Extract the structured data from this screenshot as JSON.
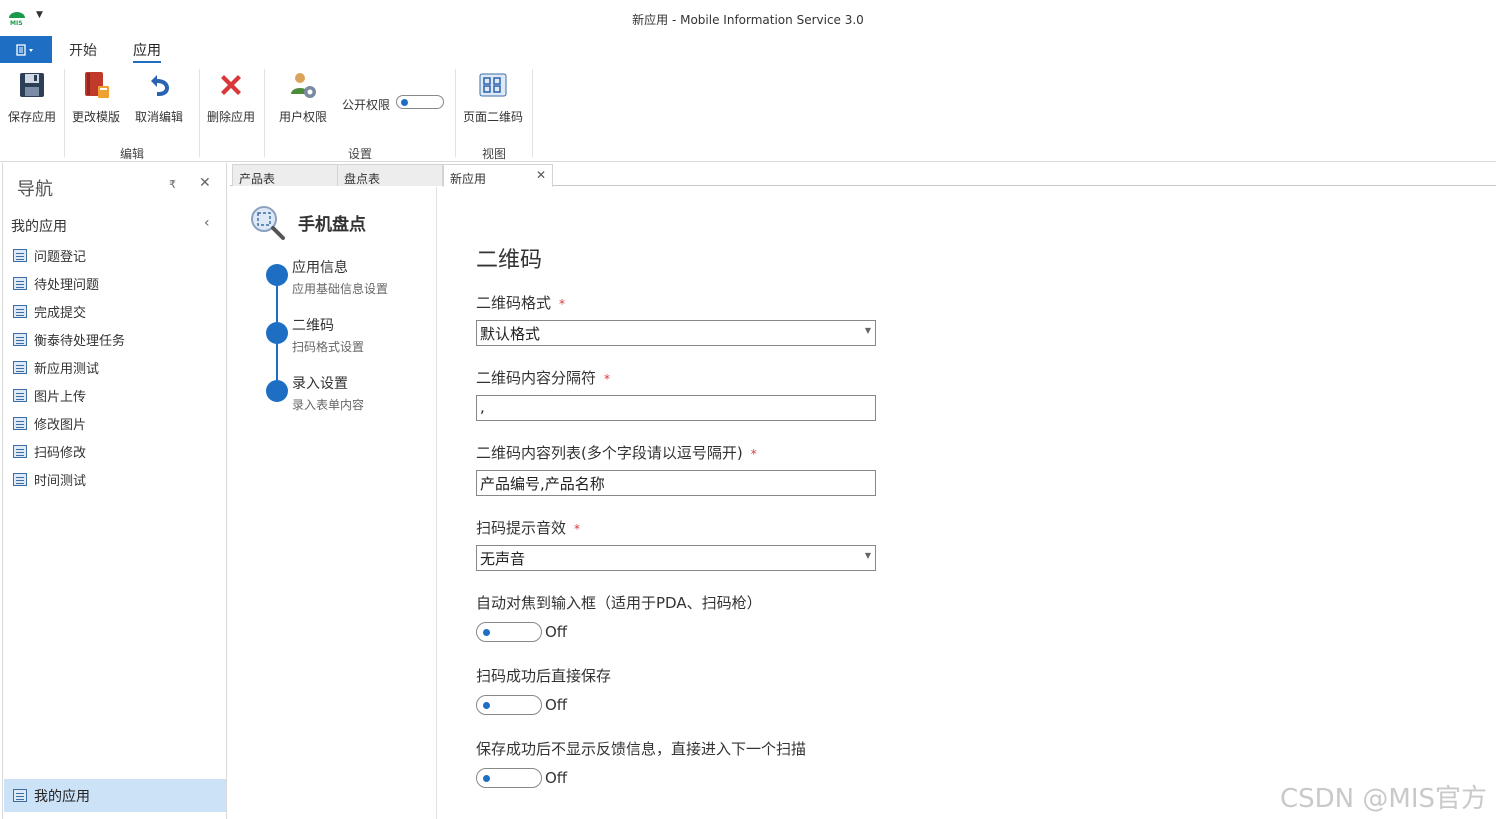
{
  "window": {
    "title": "新应用 - Mobile Information Service 3.0"
  },
  "ribbon": {
    "tabs": [
      {
        "label": "开始"
      },
      {
        "label": "应用"
      }
    ],
    "buttons": {
      "save": "保存应用",
      "change_template": "更改模版",
      "cancel_edit": "取消编辑",
      "delete_app": "删除应用",
      "user_permission": "用户权限",
      "public_permission": "公开权限",
      "page_qrcode": "页面二维码"
    },
    "groups": {
      "edit": "编辑",
      "settings": "设置",
      "view": "视图"
    }
  },
  "nav": {
    "title": "导航",
    "section": "我的应用",
    "items": [
      {
        "label": "问题登记"
      },
      {
        "label": "待处理问题"
      },
      {
        "label": "完成提交"
      },
      {
        "label": "衡泰待处理任务"
      },
      {
        "label": "新应用测试"
      },
      {
        "label": "图片上传"
      },
      {
        "label": "修改图片"
      },
      {
        "label": "扫码修改"
      },
      {
        "label": "时间测试"
      }
    ],
    "footer": "我的应用"
  },
  "doc_tabs": [
    {
      "label": "产品表"
    },
    {
      "label": "盘点表"
    },
    {
      "label": "新应用"
    }
  ],
  "steps": {
    "title": "手机盘点",
    "items": [
      {
        "name": "应用信息",
        "desc": "应用基础信息设置"
      },
      {
        "name": "二维码",
        "desc": "扫码格式设置"
      },
      {
        "name": "录入设置",
        "desc": "录入表单内容"
      }
    ]
  },
  "form": {
    "heading": "二维码",
    "qr_format": {
      "label": "二维码格式",
      "value": "默认格式"
    },
    "separator": {
      "label": "二维码内容分隔符",
      "value": ","
    },
    "content_list": {
      "label": "二维码内容列表(多个字段请以逗号隔开)",
      "value": "产品编号,产品名称"
    },
    "sound": {
      "label": "扫码提示音效",
      "value": "无声音"
    },
    "auto_focus": {
      "label": "自动对焦到输入框（适用于PDA、扫码枪）",
      "state": "Off"
    },
    "save_on_scan": {
      "label": "扫码成功后直接保存",
      "state": "Off"
    },
    "no_feedback": {
      "label": "保存成功后不显示反馈信息，直接进入下一个扫描",
      "state": "Off"
    },
    "required_mark": "*"
  },
  "watermark": "CSDN @MIS官方",
  "colors": {
    "accent": "#1e6fc3",
    "required": "#d9383a"
  }
}
